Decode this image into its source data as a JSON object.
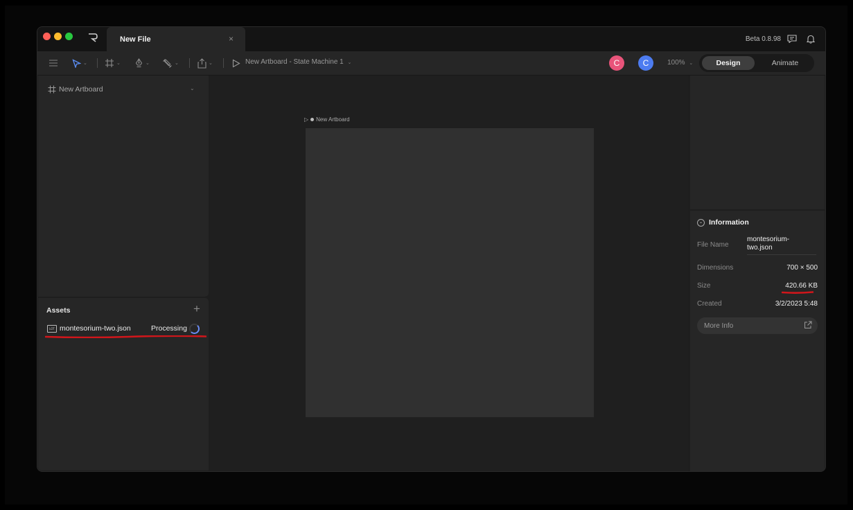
{
  "window": {
    "tab_title": "New File",
    "tab_close": "×",
    "version": "Beta 0.8.98",
    "logo": "R"
  },
  "toolbar": {
    "state_machine_label": "New Artboard - State Machine 1",
    "state_machine_caret": "⌄",
    "zoom": "100%",
    "avatars": [
      "C",
      "C"
    ],
    "mode_design": "Design",
    "mode_animate": "Animate",
    "caret": "⌄"
  },
  "hierarchy": {
    "artboard_label": "New Artboard",
    "caret": "⌄"
  },
  "assets": {
    "title": "Assets",
    "add": "+",
    "items": [
      {
        "icon_text": "LOT",
        "name": "montesorium-two.json",
        "status": "Processing"
      }
    ],
    "highlight_color": "#d0161b"
  },
  "canvas": {
    "artboard_name": "New Artboard",
    "play_glyph": "▷"
  },
  "information": {
    "title": "Information",
    "toggle_glyph": "⌄",
    "file_name_label": "File Name",
    "file_name_value": "montesorium-two.json",
    "dimensions_label": "Dimensions",
    "dimensions_value": "700 × 500",
    "size_label": "Size",
    "size_value": "420.66 KB",
    "created_label": "Created",
    "created_value": "3/2/2023 5:48",
    "more_info_label": "More Info"
  },
  "colors": {
    "accent_blue": "#4d7cf0",
    "accent_pink": "#e8547a",
    "annotation_red": "#d0161b"
  }
}
